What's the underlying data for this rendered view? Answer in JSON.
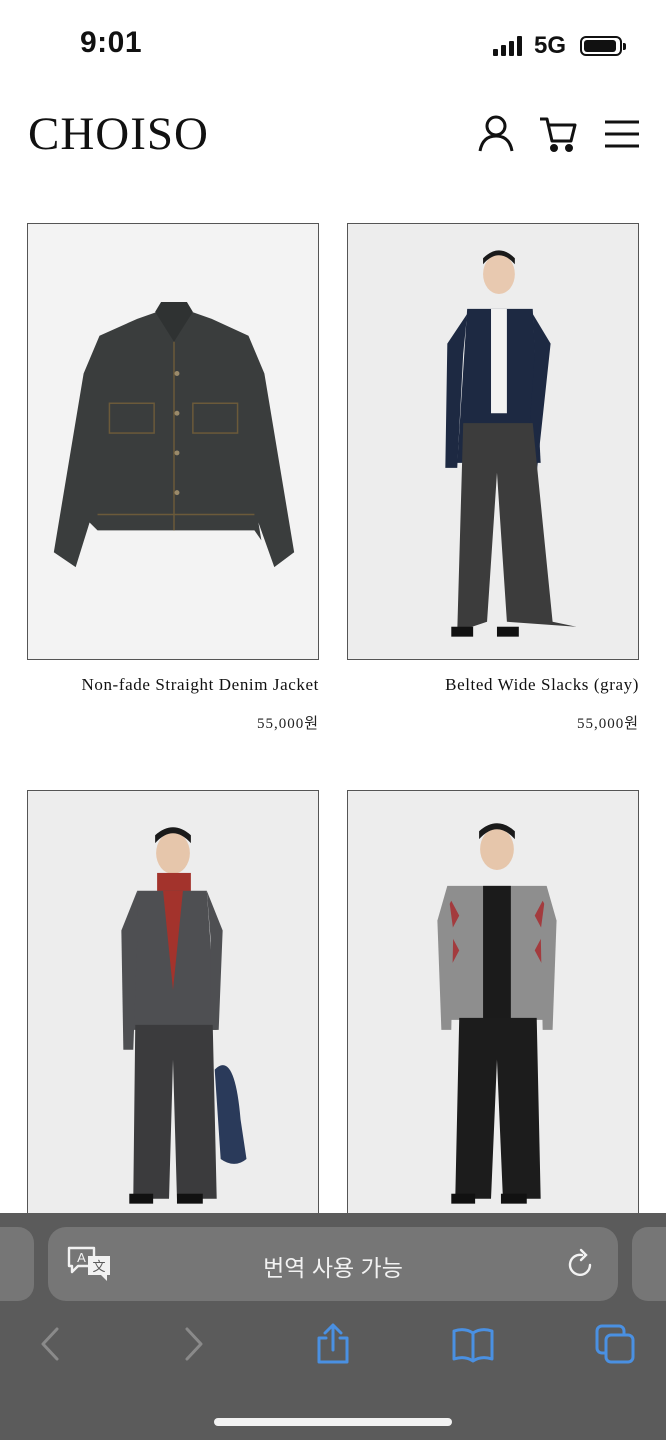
{
  "status_bar": {
    "time": "9:01",
    "network": "5G"
  },
  "site": {
    "logo": "CHOISO"
  },
  "header_icons": [
    "user-icon",
    "cart-icon",
    "menu-icon"
  ],
  "products": [
    {
      "name": "Non-fade Straight Denim Jacket",
      "price": "55,000원"
    },
    {
      "name": "Belted Wide Slacks (gray)",
      "price": "55,000원"
    },
    {
      "name": "",
      "price": ""
    },
    {
      "name": "",
      "price": ""
    }
  ],
  "browser": {
    "address_text": "번역 사용 가능",
    "toolbar_icons": [
      "back-icon",
      "forward-icon",
      "share-icon",
      "bookmarks-icon",
      "tabs-icon"
    ]
  },
  "colors": {
    "accent": "#4a90e2",
    "browser_bg": "#5b5b5b",
    "field_bg": "#767676"
  }
}
